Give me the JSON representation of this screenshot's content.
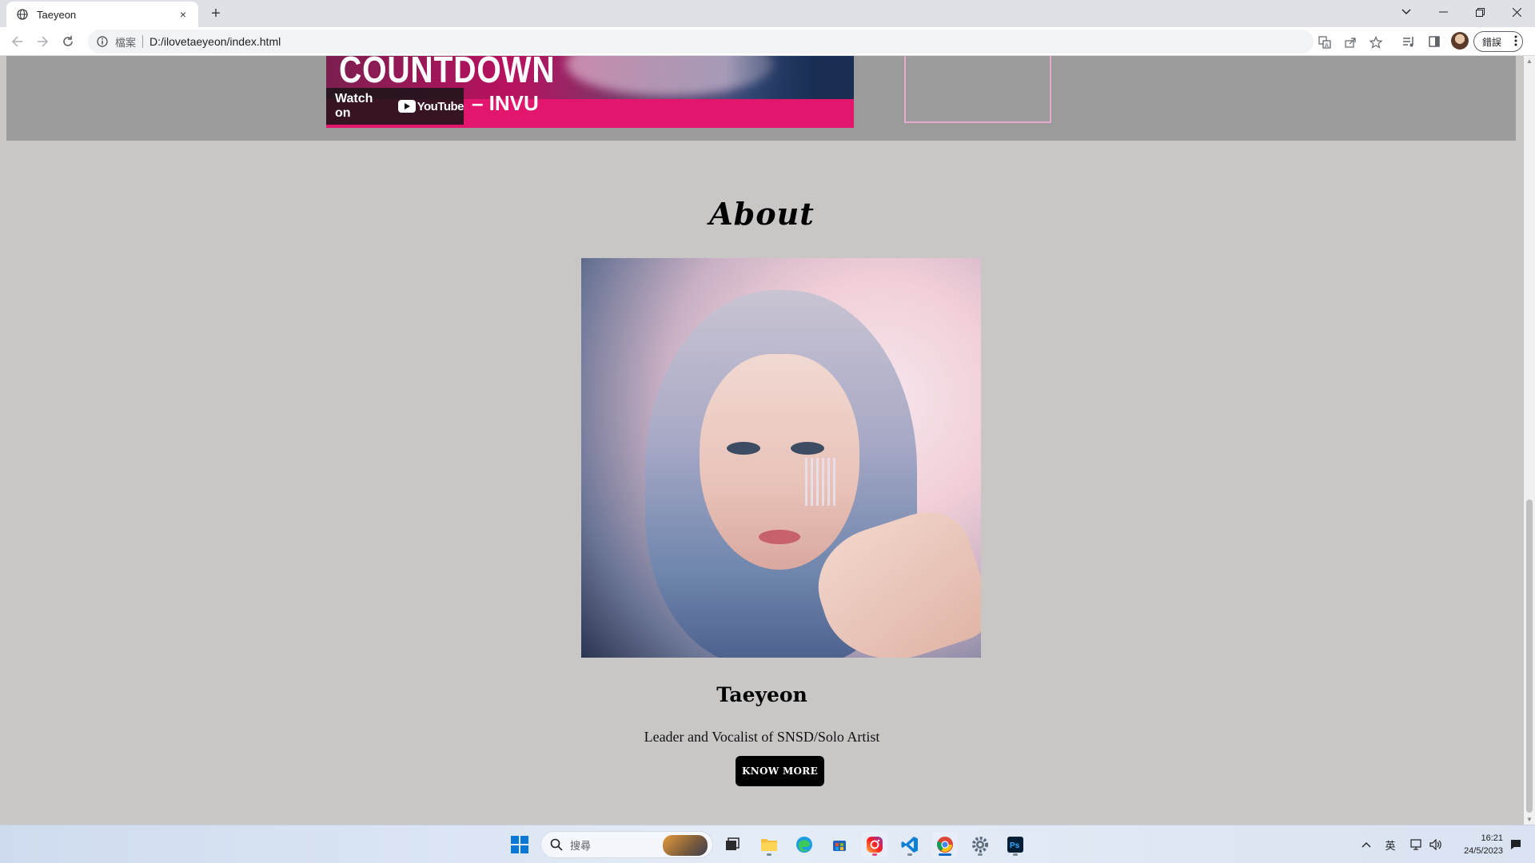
{
  "browser": {
    "tab_title": "Taeyeon",
    "tab_close": "×",
    "new_tab": "+",
    "address_scheme_label": "檔案",
    "address_url": "D:/ilovetaeyeon/index.html",
    "profile_label": "錯誤"
  },
  "video": {
    "title_fragment": "COUNTDOWN",
    "song_label": "– INVU",
    "watch_on_label": "Watch on",
    "youtube_label": "YouTube"
  },
  "about": {
    "heading": "About",
    "name": "Taeyeon",
    "subtitle": "Leader and Vocalist of SNSD/Solo Artist",
    "button_label": "KNOW MORE"
  },
  "taskbar": {
    "search_placeholder": "搜尋",
    "ime_label": "英",
    "time": "16:21",
    "date": "24/5/2023"
  },
  "icons": {
    "tab": [
      "globe-icon"
    ],
    "toolbar": [
      "back-arrow-icon",
      "forward-arrow-icon",
      "reload-icon",
      "info-icon",
      "translate-icon",
      "share-icon",
      "star-icon",
      "media-icon",
      "side-panel-icon",
      "menu-dots-icon"
    ],
    "taskbar": [
      "windows-start-icon",
      "search-icon",
      "task-view-icon",
      "file-explorer-icon",
      "edge-icon",
      "store-icon",
      "instagram-icon",
      "vscode-icon",
      "chrome-icon",
      "settings-icon",
      "photoshop-icon"
    ],
    "tray": [
      "chevron-up-icon",
      "network-icon",
      "volume-icon",
      "notification-icon"
    ]
  },
  "colors": {
    "page_background": "#c9c6c6",
    "video_band": "#9c9b9b",
    "button_background": "#000000",
    "youtube_red": "#e3166e",
    "pink_frame": "#e8a9cf"
  }
}
